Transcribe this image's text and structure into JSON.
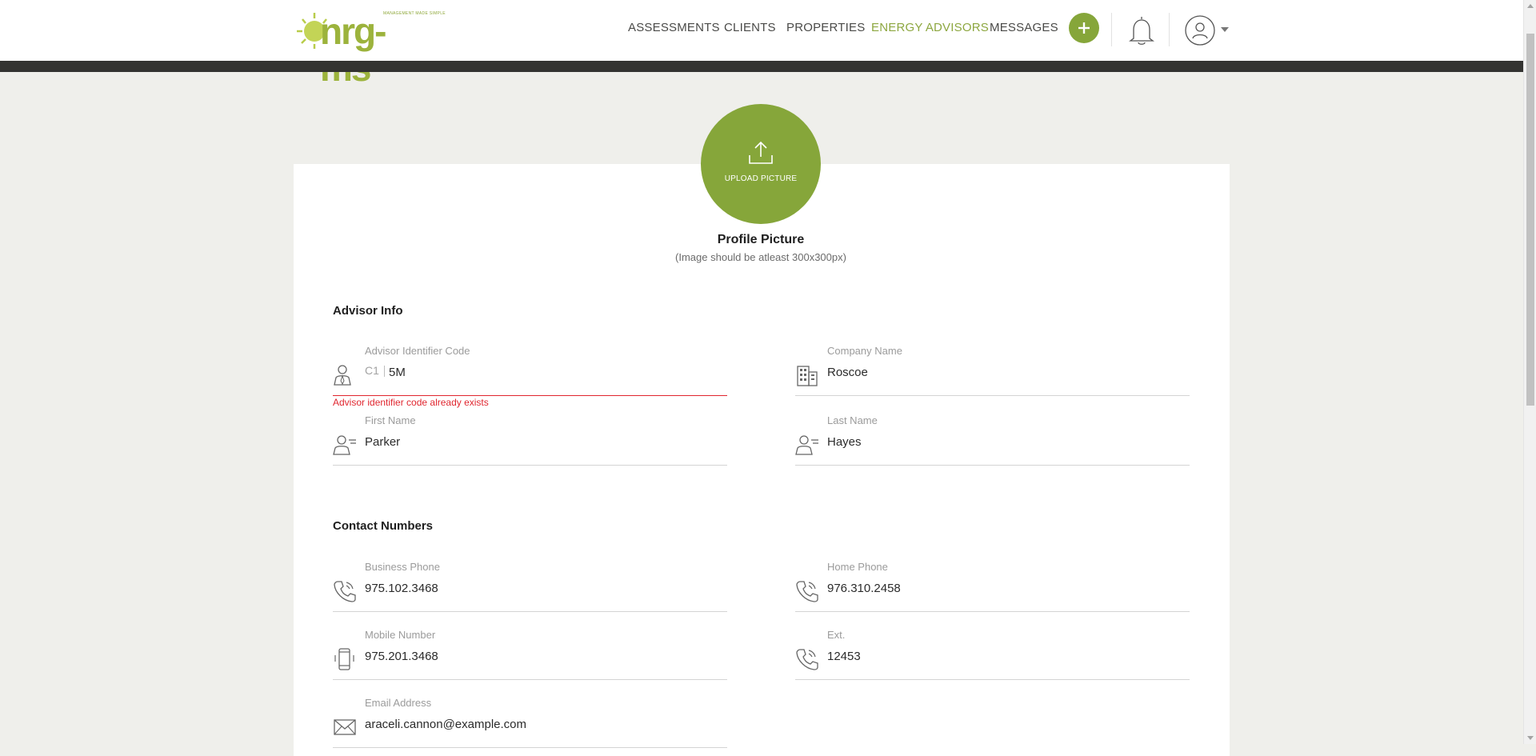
{
  "brand": {
    "logo_text": "nrg-ms",
    "tagline": "MANAGEMENT MADE SIMPLE"
  },
  "nav": {
    "items": [
      {
        "label": "ASSESSMENTS",
        "active": false
      },
      {
        "label": "CLIENTS",
        "active": false
      },
      {
        "label": "PROPERTIES",
        "active": false
      },
      {
        "label": "ENERGY ADVISORS",
        "active": true
      },
      {
        "label": "MESSAGES",
        "active": false
      }
    ],
    "add_icon": "plus-icon",
    "notification_icon": "bell-icon",
    "user_icon": "user-avatar-icon",
    "menu_icon": "caret-down-icon"
  },
  "colors": {
    "accent": "#86a63a",
    "active_nav": "#8da740",
    "error": "#e0262f",
    "header_bar": "#333331",
    "page_bg": "#efefeb"
  },
  "profile": {
    "upload_label": "UPLOAD PICTURE",
    "title": "Profile Picture",
    "subtitle": "(Image should be atleast 300x300px)"
  },
  "advisor_info": {
    "title": "Advisor Info",
    "identifier": {
      "label": "Advisor Identifier Code",
      "prefix": "C1",
      "value": "5M",
      "error": "Advisor identifier code already exists",
      "icon": "advisor-icon"
    },
    "company": {
      "label": "Company Name",
      "value": "Roscoe",
      "icon": "building-icon"
    },
    "first_name": {
      "label": "First Name",
      "value": "Parker",
      "icon": "person-card-icon"
    },
    "last_name": {
      "label": "Last Name",
      "value": "Hayes",
      "icon": "person-card-icon"
    }
  },
  "contact": {
    "title": "Contact Numbers",
    "business_phone": {
      "label": "Business Phone",
      "value": "975.102.3468",
      "icon": "phone-icon"
    },
    "home_phone": {
      "label": "Home Phone",
      "value": "976.310.2458",
      "icon": "phone-icon"
    },
    "mobile": {
      "label": "Mobile Number",
      "value": "975.201.3468",
      "icon": "mobile-icon"
    },
    "ext": {
      "label": "Ext.",
      "value": "12453",
      "icon": "phone-icon"
    },
    "email": {
      "label": "Email Address",
      "value": "araceli.cannon@example.com",
      "icon": "envelope-icon"
    }
  }
}
